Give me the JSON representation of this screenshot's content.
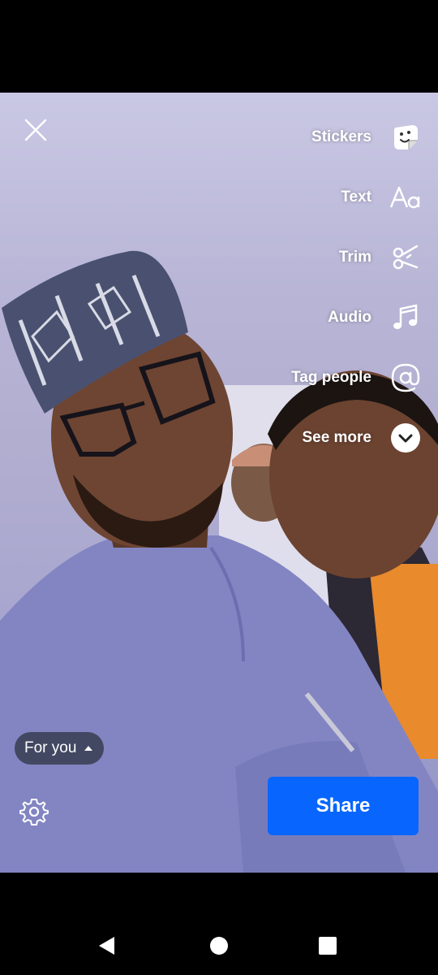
{
  "editor": {
    "close_icon": "close-icon",
    "tools": [
      {
        "label": "Stickers",
        "icon": "sticker-icon"
      },
      {
        "label": "Text",
        "icon": "text-aa-icon"
      },
      {
        "label": "Trim",
        "icon": "scissors-icon"
      },
      {
        "label": "Audio",
        "icon": "music-note-icon"
      },
      {
        "label": "Tag people",
        "icon": "at-sign-icon"
      },
      {
        "label": "See more",
        "icon": "chevron-down-icon"
      }
    ],
    "audience_selector": {
      "label": "For you",
      "icon": "caret-up-icon"
    },
    "settings_icon": "gear-icon",
    "share_label": "Share",
    "accent_color": "#0866ff"
  },
  "navigation_bar": {
    "buttons": [
      "back-icon",
      "home-icon",
      "recents-icon"
    ]
  }
}
